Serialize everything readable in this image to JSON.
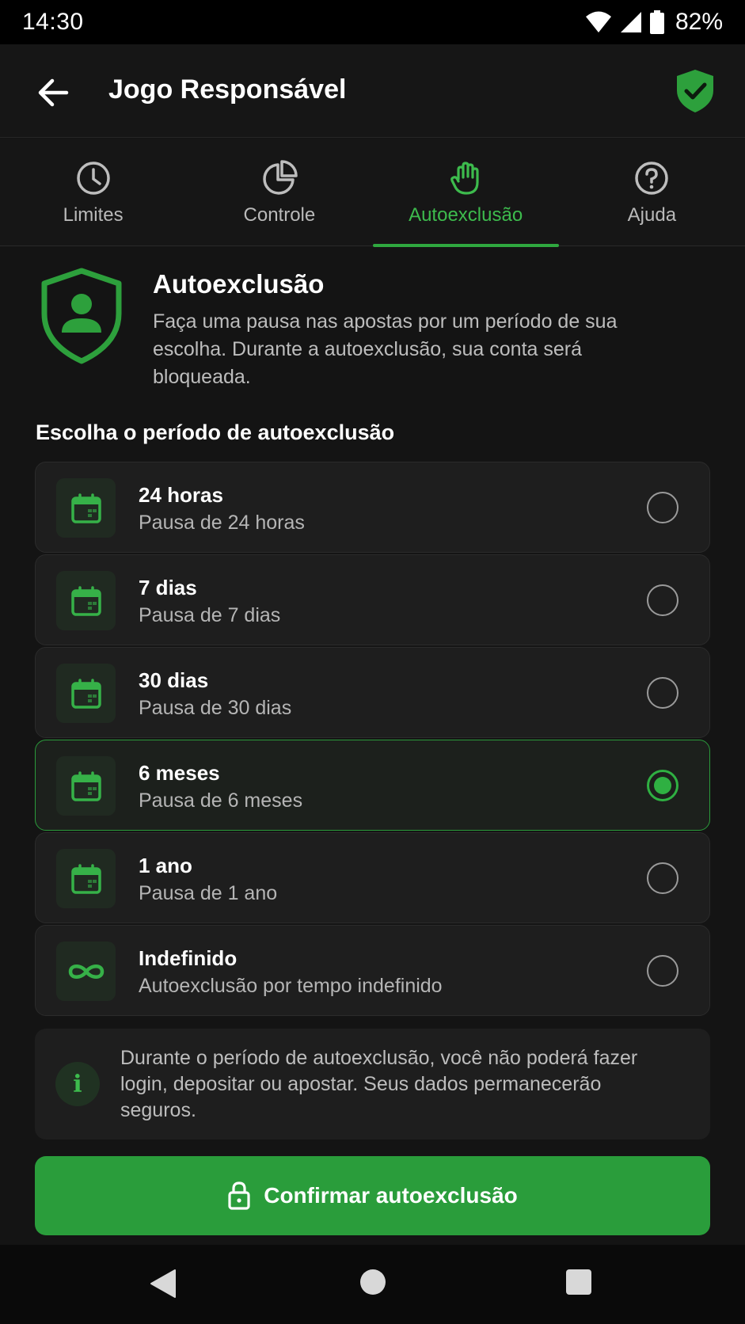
{
  "status_bar": {
    "time": "14:30",
    "battery": "82%"
  },
  "app_bar": {
    "title": "Jogo Responsável"
  },
  "tabs": [
    {
      "label": "Limites",
      "icon": "clock-icon"
    },
    {
      "label": "Controle",
      "icon": "pie-chart-icon"
    },
    {
      "label": "Autoexclusão",
      "icon": "hand-icon",
      "active": true
    },
    {
      "label": "Ajuda",
      "icon": "help-icon"
    }
  ],
  "intro": {
    "title": "Autoexclusão",
    "description": "Faça uma pausa nas apostas por um período de sua escolha. Durante a autoexclusão, sua conta será bloqueada."
  },
  "section_label": "Escolha o período de autoexclusão",
  "options": [
    {
      "title": "24 horas",
      "subtitle": "Pausa de 24 horas",
      "icon": "calendar-icon",
      "selected": false
    },
    {
      "title": "7 dias",
      "subtitle": "Pausa de 7 dias",
      "icon": "calendar-icon",
      "selected": false
    },
    {
      "title": "30 dias",
      "subtitle": "Pausa de 30 dias",
      "icon": "calendar-icon",
      "selected": false
    },
    {
      "title": "6 meses",
      "subtitle": "Pausa de 6 meses",
      "icon": "calendar-icon",
      "selected": true
    },
    {
      "title": "1 ano",
      "subtitle": "Pausa de 1 ano",
      "icon": "calendar-icon",
      "selected": false
    },
    {
      "title": "Indefinido",
      "subtitle": "Autoexclusão por tempo indefinido",
      "icon": "infinity-icon",
      "selected": false
    }
  ],
  "info": {
    "icon_glyph": "i",
    "text": "Durante o período de autoexclusão, você não poderá fazer login, depositar ou apostar. Seus dados permanecerão seguros."
  },
  "confirm_button": {
    "label": "Confirmar autoexclusão"
  },
  "colors": {
    "accent": "#2fb042",
    "button": "#2a9d3b",
    "background": "#141414"
  }
}
